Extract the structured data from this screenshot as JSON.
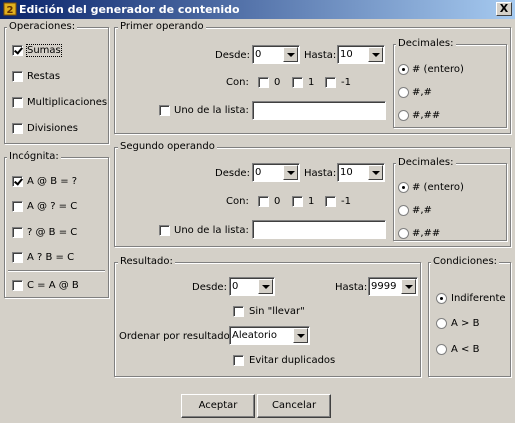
{
  "window": {
    "title": "Edición del generador de contenido",
    "close_label": "X"
  },
  "operaciones": {
    "legend": "Operaciones:",
    "items": [
      {
        "label": "Sumas",
        "checked": true
      },
      {
        "label": "Restas",
        "checked": false
      },
      {
        "label": "Multiplicaciones",
        "checked": false
      },
      {
        "label": "Divisiones",
        "checked": false
      }
    ]
  },
  "incognita": {
    "legend": "Incógnita:",
    "items": [
      {
        "label": "A @ B = ?",
        "checked": true
      },
      {
        "label": "A @ ? = C",
        "checked": false
      },
      {
        "label": "? @ B = C",
        "checked": false
      },
      {
        "label": "A ? B = C",
        "checked": false
      },
      {
        "label": "C = A @ B",
        "checked": false
      }
    ]
  },
  "primer": {
    "legend": "Primer operando",
    "desde_label": "Desde:",
    "desde_value": "0",
    "hasta_label": "Hasta:",
    "hasta_value": "10",
    "con_label": "Con:",
    "con_opts": [
      "0",
      "1",
      "-1"
    ],
    "lista_label": "Uno de la lista:",
    "lista_value": "",
    "decimales_legend": "Decimales:",
    "decimales": [
      "# (entero)",
      "#,#",
      "#,##"
    ]
  },
  "segundo": {
    "legend": "Segundo operando",
    "desde_label": "Desde:",
    "desde_value": "0",
    "hasta_label": "Hasta:",
    "hasta_value": "10",
    "con_label": "Con:",
    "con_opts": [
      "0",
      "1",
      "-1"
    ],
    "lista_label": "Uno de la lista:",
    "lista_value": "",
    "decimales_legend": "Decimales:",
    "decimales": [
      "# (entero)",
      "#,#",
      "#,##"
    ]
  },
  "resultado": {
    "legend": "Resultado:",
    "desde_label": "Desde:",
    "desde_value": "0",
    "hasta_label": "Hasta:",
    "hasta_value": "9999",
    "sin_llevar_label": "Sin \"llevar\"",
    "ordenar_label": "Ordenar por resultado:",
    "ordenar_value": "Aleatorio",
    "evitar_label": "Evitar duplicados"
  },
  "condiciones": {
    "legend": "Condiciones:",
    "items": [
      "Indiferente",
      "A > B",
      "A < B"
    ]
  },
  "buttons": {
    "accept": "Aceptar",
    "cancel": "Cancelar"
  }
}
